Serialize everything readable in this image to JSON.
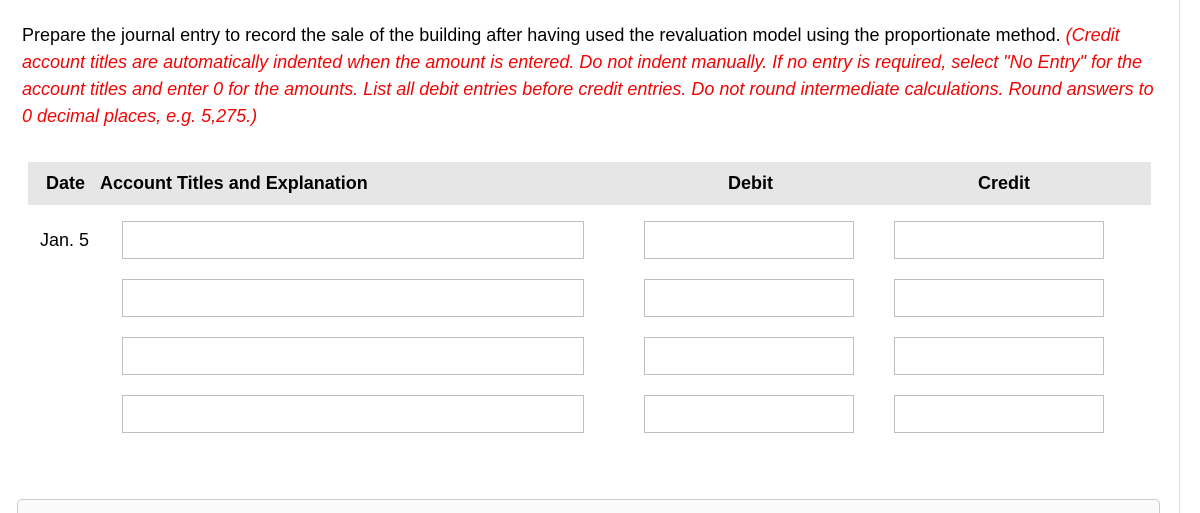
{
  "instructions": {
    "black": "Prepare the journal entry to record the sale of the building after having used the revaluation model using the proportionate method. ",
    "red": "(Credit account titles are automatically indented when the amount is entered. Do not indent manually. If no entry is required, select \"No Entry\" for the account titles and enter 0 for the amounts. List all debit entries before credit entries. Do not round intermediate calculations. Round answers to 0 decimal places, e.g. 5,275.)"
  },
  "headers": {
    "date": "Date",
    "account": "Account Titles and Explanation",
    "debit": "Debit",
    "credit": "Credit"
  },
  "rows": [
    {
      "date": "Jan. 5",
      "account": "",
      "debit": "",
      "credit": ""
    },
    {
      "date": "",
      "account": "",
      "debit": "",
      "credit": ""
    },
    {
      "date": "",
      "account": "",
      "debit": "",
      "credit": ""
    },
    {
      "date": "",
      "account": "",
      "debit": "",
      "credit": ""
    }
  ]
}
